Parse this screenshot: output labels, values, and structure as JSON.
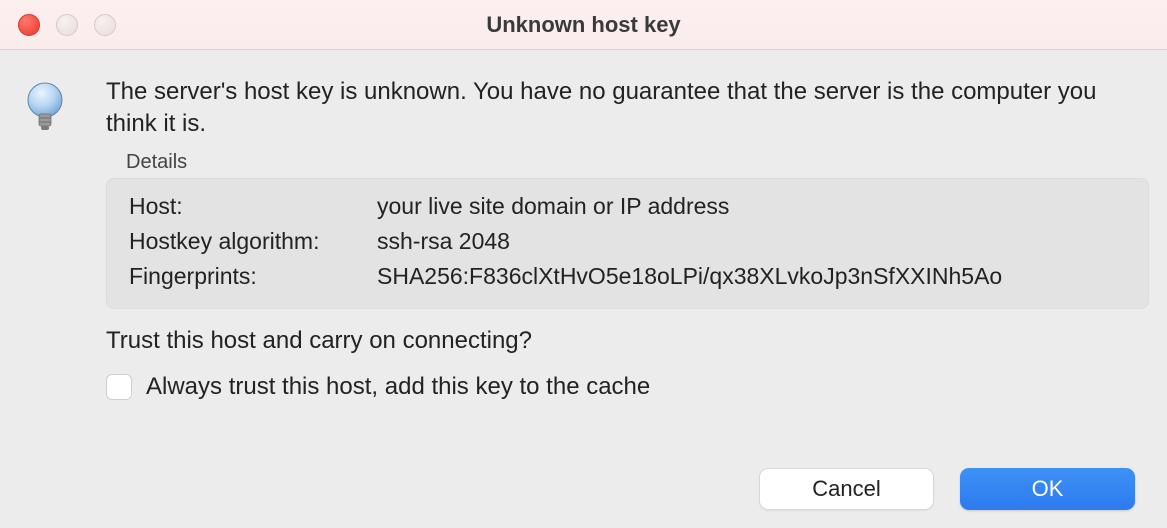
{
  "window": {
    "title": "Unknown host key"
  },
  "dialog": {
    "message": "The server's host key is unknown. You have no guarantee that the server is the computer you think it is.",
    "details_label": "Details",
    "rows": {
      "host_label": "Host:",
      "host_value": "your live site domain or IP address",
      "algo_label": "Hostkey algorithm:",
      "algo_value": "ssh-rsa 2048",
      "fp_label": "Fingerprints:",
      "fp_value": "SHA256:F836clXtHvO5e18oLPi/qx38XLvkoJp3nSfXXINh5Ao"
    },
    "question": "Trust this host and carry on connecting?",
    "checkbox_label": "Always trust this host, add this key to the cache"
  },
  "buttons": {
    "cancel": "Cancel",
    "ok": "OK"
  },
  "icons": {
    "info": "lightbulb-icon"
  }
}
